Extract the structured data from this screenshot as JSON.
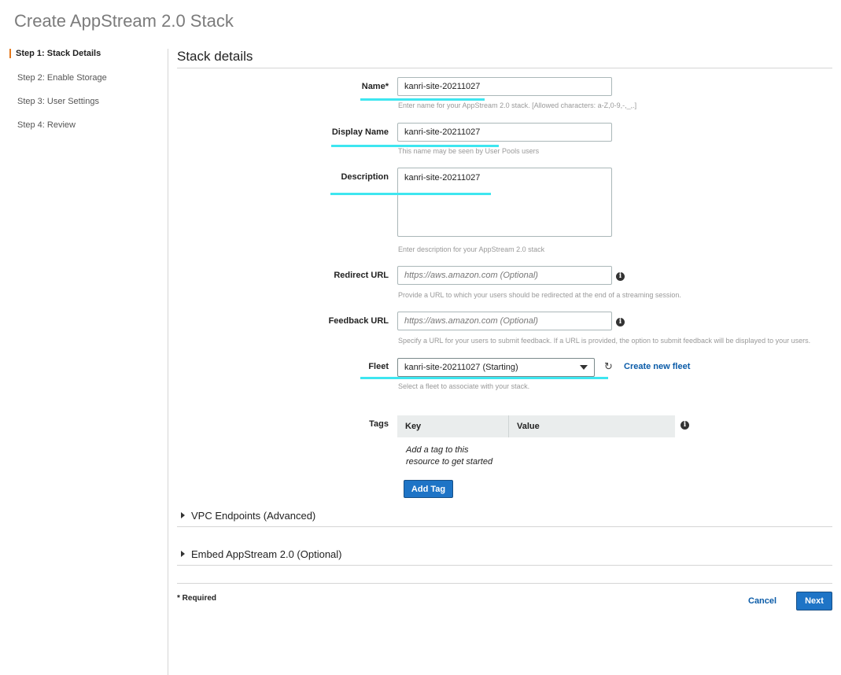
{
  "page": {
    "title": "Create AppStream 2.0 Stack"
  },
  "steps": [
    {
      "label": "Step 1: Stack Details",
      "active": true
    },
    {
      "label": "Step 2: Enable Storage",
      "active": false
    },
    {
      "label": "Step 3: User Settings",
      "active": false
    },
    {
      "label": "Step 4: Review",
      "active": false
    }
  ],
  "section": {
    "title": "Stack details"
  },
  "form": {
    "name": {
      "label": "Name*",
      "value": "kanri-site-20211027",
      "help": "Enter name for your AppStream 2.0 stack. [Allowed characters: a-Z,0-9,-,_,.]"
    },
    "display_name": {
      "label": "Display Name",
      "value": "kanri-site-20211027",
      "help": "This name may be seen by User Pools users"
    },
    "description": {
      "label": "Description",
      "value": "kanri-site-20211027",
      "help": "Enter description for your AppStream 2.0 stack"
    },
    "redirect_url": {
      "label": "Redirect URL",
      "placeholder": "https://aws.amazon.com (Optional)",
      "help": "Provide a URL to which your users should be redirected at the end of a streaming session.",
      "info_icon": "i"
    },
    "feedback_url": {
      "label": "Feedback URL",
      "placeholder": "https://aws.amazon.com (Optional)",
      "help": "Specify a URL for your users to submit feedback. If a URL is provided, the option to submit feedback will be displayed to your users.",
      "info_icon": "i"
    },
    "fleet": {
      "label": "Fleet",
      "value": "kanri-site-20211027 (Starting)",
      "help": "Select a fleet to associate with your stack.",
      "create_link": "Create new fleet",
      "refresh_icon": "refresh-icon"
    },
    "tags": {
      "label": "Tags",
      "columns": [
        "Key",
        "Value"
      ],
      "empty_text": "Add a tag to this resource to get started",
      "add_button": "Add Tag",
      "info_icon": "i"
    }
  },
  "sections": {
    "vpc": "VPC Endpoints (Advanced)",
    "embed": "Embed AppStream 2.0 (Optional)"
  },
  "footer": {
    "required_note": "* Required",
    "cancel": "Cancel",
    "next": "Next"
  },
  "colors": {
    "accent": "#e4781c",
    "primary_button": "#1e74c6",
    "link": "#0a5ba8",
    "highlight": "#3ee6f0"
  }
}
